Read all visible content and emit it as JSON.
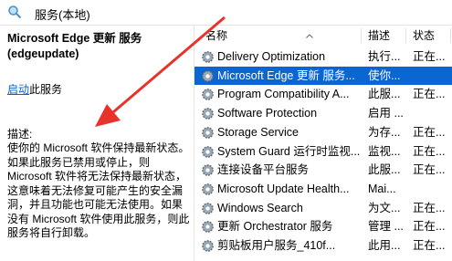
{
  "window": {
    "title": "服务(本地)"
  },
  "detail": {
    "service_name_line1": "Microsoft Edge 更新 服务",
    "service_name_line2": "(edgeupdate)",
    "start_link": "启动",
    "start_suffix": "此服务",
    "description_label": "描述:",
    "description": "使你的 Microsoft 软件保持最新状态。如果此服务已禁用或停止，则 Microsoft 软件将无法保持最新状态，这意味着无法修复可能产生的安全漏洞，并且功能也可能无法使用。如果没有 Microsoft 软件使用此服务，则此服务将自行卸载。"
  },
  "table": {
    "headers": {
      "name": "名称",
      "description": "描述",
      "status": "状态"
    },
    "rows": [
      {
        "name": "Delivery Optimization",
        "description": "执行...",
        "status": "正在..."
      },
      {
        "name": "Microsoft Edge 更新 服务...",
        "description": "使你...",
        "status": ""
      },
      {
        "name": "Program Compatibility A...",
        "description": "此服...",
        "status": "正在..."
      },
      {
        "name": "Software Protection",
        "description": "启用 ...",
        "status": ""
      },
      {
        "name": "Storage Service",
        "description": "为存...",
        "status": "正在..."
      },
      {
        "name": "System Guard 运行时监视...",
        "description": "监视...",
        "status": "正在..."
      },
      {
        "name": "连接设备平台服务",
        "description": "此服...",
        "status": "正在..."
      },
      {
        "name": "Microsoft Update Health...",
        "description": "Mai...",
        "status": ""
      },
      {
        "name": "Windows Search",
        "description": "为文...",
        "status": "正在..."
      },
      {
        "name": "更新 Orchestrator 服务",
        "description": "管理 ...",
        "status": "正在..."
      },
      {
        "name": "剪贴板用户服务_410f...",
        "description": "此用...",
        "status": "正在..."
      }
    ],
    "selected_index": 1
  },
  "colors": {
    "selection": "#0a66d2",
    "link": "#0b61c4",
    "arrow": "#e8322b"
  }
}
